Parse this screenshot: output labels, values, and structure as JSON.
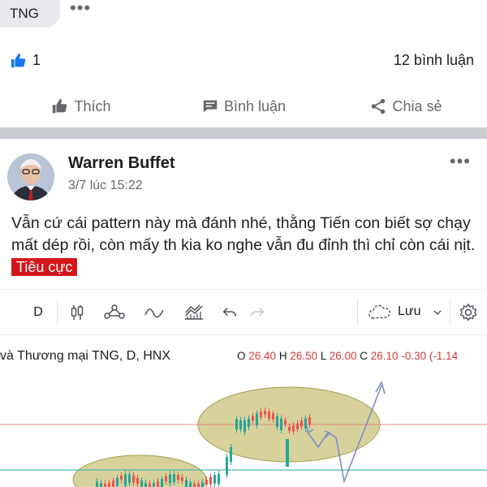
{
  "top_post": {
    "tag": "TNG",
    "more": "•••",
    "like_count": "1",
    "comment_count": "12 bình luận",
    "actions": {
      "like": "Thích",
      "comment": "Bình luận",
      "share": "Chia sẻ"
    }
  },
  "post": {
    "author": "Warren Buffet",
    "time": "3/7 lúc 15:22",
    "more": "•••",
    "text": "Vẫn cứ cái pattern này mà đánh nhé, thằng Tiến con biết sợ chạy mất dép rồi, còn mấy th kia ko nghe vẫn đu đỉnh thì chỉ còn cái nịt.",
    "sentiment_label": "Tiêu cực"
  },
  "chart": {
    "interval": "D",
    "save_label": "Lưu",
    "symbol": "và Thương mại TNG, D, HNX",
    "ohlc": {
      "o_label": "O",
      "o": "26.40",
      "h_label": "H",
      "h": "26.50",
      "l_label": "L",
      "l": "26.00",
      "c_label": "C",
      "c": "26.10",
      "change": "-0.30 (-1.14"
    },
    "colors": {
      "up": "#26a69a",
      "down": "#ef5350",
      "ellipse_fill": "#c9c27a",
      "arrow": "#7b8fc7",
      "resistance": "#e57373",
      "support": "#4db6ac"
    }
  },
  "icons": [
    "thumbs-up-icon",
    "comment-icon",
    "share-icon",
    "candles-icon",
    "indicators-icon",
    "line-icon",
    "drawing-icon",
    "undo-icon",
    "redo-icon",
    "cloud-icon",
    "chevron-down-icon",
    "gear-icon"
  ]
}
